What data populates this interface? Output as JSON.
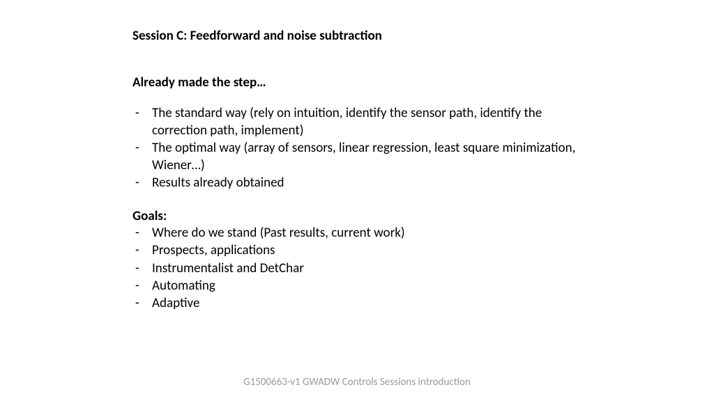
{
  "title": "Session C:  Feedforward and noise subtraction",
  "subtitle": "Already made the step…",
  "section1": {
    "items": [
      "The standard way (rely on intuition, identify the sensor path,  identify the correction path, implement)",
      "The optimal way (array of sensors, linear regression, least square minimization, Wiener…)",
      "Results already obtained"
    ]
  },
  "goals_heading": "Goals:",
  "goals": {
    "items": [
      "Where do we stand (Past results, current work)",
      "Prospects, applications",
      "Instrumentalist and DetChar",
      "Automating",
      "Adaptive"
    ]
  },
  "footer": "G1500663-v1 GWADW Controls Sessions introduction"
}
